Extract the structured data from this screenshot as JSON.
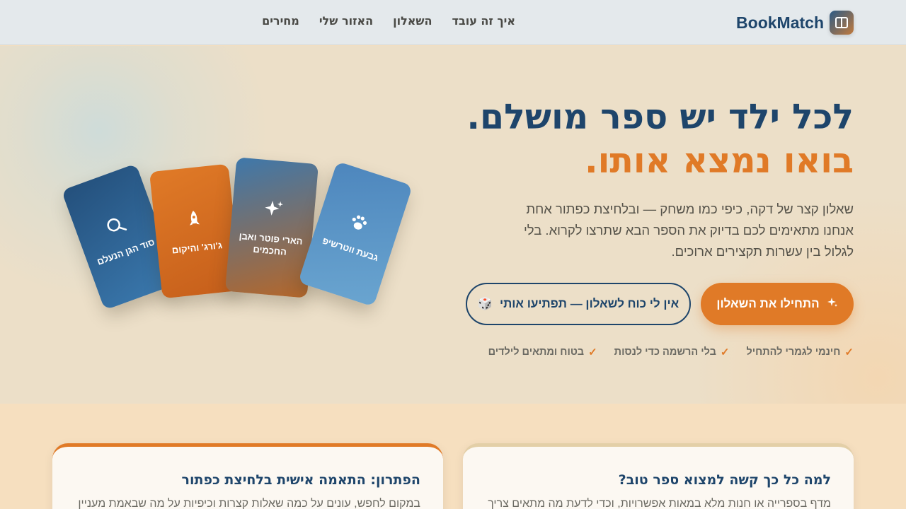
{
  "brand": {
    "name": "BookMatch",
    "icon": "book-icon"
  },
  "nav": {
    "links": [
      {
        "label": "איך זה עובד"
      },
      {
        "label": "השאלון"
      },
      {
        "label": "האזור שלי"
      },
      {
        "label": "מחירים"
      }
    ]
  },
  "hero": {
    "headline_line1": "לכל ילד יש ספר מושלם.",
    "headline_line2": "בואו נמצא אותו.",
    "subtext": "שאלון קצר של דקה, כיפי כמו משחק — ובלחיצת כפתור אחת אנחנו מתאימים לכם בדיוק את הספר הבא שתרצו לקרוא. בלי לגלול בין עשרות תקצירים ארוכים.",
    "primary_button": {
      "label": "התחילו את השאלון",
      "icon": "sparkle-icon"
    },
    "secondary_button": {
      "label": "אין לי כוח לשאלון — תפתיעו אותי",
      "icon": "dice-icon",
      "emoji": "🎲"
    },
    "features": [
      {
        "label": "חינמי לגמרי להתחיל",
        "icon": "check-icon"
      },
      {
        "label": "בלי הרשמה כדי לנסות",
        "icon": "check-icon"
      },
      {
        "label": "בטוח ומתאים לילדים",
        "icon": "check-icon"
      }
    ]
  },
  "book_cards": [
    {
      "title": "סוד הגן הנעלם",
      "icon": "magnifier-icon",
      "color": "#2b5c8c"
    },
    {
      "title": "ג'ורג' והיקום",
      "icon": "rocket-icon",
      "color": "#e07a27"
    },
    {
      "title": "הארי פוטר ואבן החכמים",
      "icon": "sparkle-icon",
      "color": "#7a6e6a"
    },
    {
      "title": "גבעת ווטרשיפ",
      "icon": "paw-icon",
      "color": "#5a95c6"
    }
  ],
  "sections": {
    "problem": {
      "title": "למה כל כך קשה למצוא ספר טוב?",
      "text": "מדף בספרייה או חנות מלא במאות אפשרויות, וכדי לדעת מה מתאים צריך"
    },
    "solution": {
      "title": "הפתרון: התאמה אישית בלחיצת כפתור",
      "text": "במקום לחפש, עונים על כמה שאלות קצרות וכיפיות על מה שבאמת מעניין"
    }
  },
  "colors": {
    "primary": "#e07a27",
    "navy": "#1e456b",
    "hero_bg": "#ecdfc8",
    "section_bg": "#f6dfbf"
  }
}
